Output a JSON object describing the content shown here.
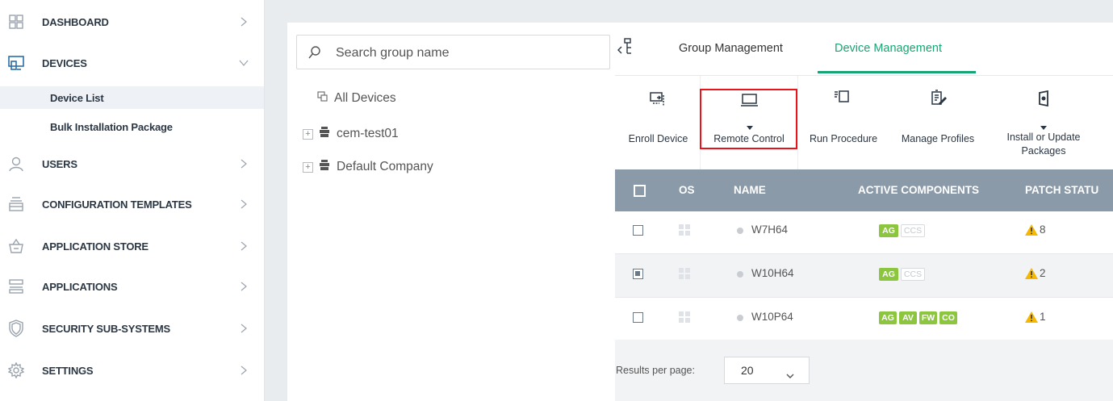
{
  "sidebar": {
    "items": [
      {
        "label": "DASHBOARD",
        "icon": "dashboard-grid-icon",
        "chevron": "right"
      },
      {
        "label": "DEVICES",
        "icon": "devices-icon",
        "chevron": "down"
      },
      {
        "label": "USERS",
        "icon": "user-icon",
        "chevron": "right"
      },
      {
        "label": "CONFIGURATION TEMPLATES",
        "icon": "templates-icon",
        "chevron": "right"
      },
      {
        "label": "APPLICATION STORE",
        "icon": "basket-icon",
        "chevron": "right"
      },
      {
        "label": "APPLICATIONS",
        "icon": "applications-icon",
        "chevron": "right"
      },
      {
        "label": "SECURITY SUB-SYSTEMS",
        "icon": "shield-icon",
        "chevron": "right"
      },
      {
        "label": "SETTINGS",
        "icon": "gear-icon",
        "chevron": "right"
      }
    ],
    "subitems": [
      {
        "label": "Device List",
        "active": true
      },
      {
        "label": "Bulk Installation Package",
        "active": false
      }
    ]
  },
  "groups": {
    "search_placeholder": "Search group name",
    "all_devices": "All Devices",
    "tree": [
      {
        "label": "cem-test01",
        "expander": "+"
      },
      {
        "label": "Default Company",
        "expander": "+"
      }
    ]
  },
  "tabs": [
    "Group Management",
    "Device Management"
  ],
  "active_tab": "Device Management",
  "toolbar": {
    "enroll": "Enroll Device",
    "remote": "Remote Control",
    "run": "Run Procedure",
    "profiles": "Manage Profiles",
    "install": "Install or Update Packages"
  },
  "table": {
    "headers": {
      "os": "OS",
      "name": "NAME",
      "components": "ACTIVE COMPONENTS",
      "patch": "PATCH STATU"
    },
    "rows": [
      {
        "name": "W7H64",
        "selected": false,
        "components": [
          "AG",
          "CCS"
        ],
        "inactive": [
          "CCS"
        ],
        "patch": "8"
      },
      {
        "name": "W10H64",
        "selected": true,
        "components": [
          "AG",
          "CCS"
        ],
        "inactive": [
          "CCS"
        ],
        "patch": "2"
      },
      {
        "name": "W10P64",
        "selected": false,
        "components": [
          "AG",
          "AV",
          "FW",
          "CO"
        ],
        "inactive": [],
        "patch": "1"
      }
    ]
  },
  "footer": {
    "results_label": "Results per page:",
    "results_value": "20"
  },
  "colors": {
    "accent": "#17a673",
    "header": "#8b9aa8",
    "badge": "#8cc63e",
    "highlight": "#e8141b",
    "warning": "#f5b700"
  }
}
